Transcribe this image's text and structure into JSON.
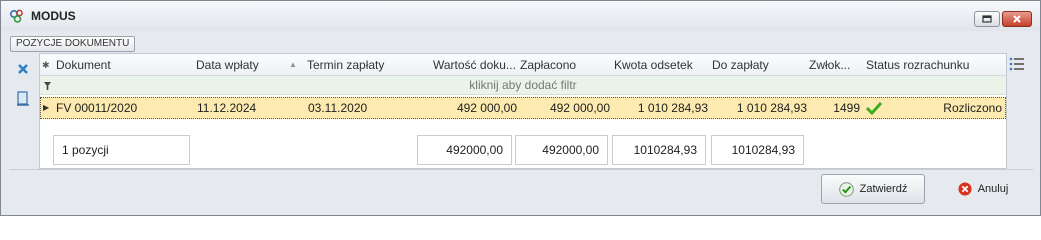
{
  "window": {
    "title": "MODUS",
    "icon": "modus-logo-icon"
  },
  "group": {
    "label": "POZYCJE DOKUMENTU"
  },
  "grid": {
    "columns": [
      "Dokument",
      "Data wpłaty",
      "Termin zapłaty",
      "Wartość doku...",
      "Zapłacono",
      "Kwota odsetek",
      "Do zapłaty",
      "Zwłok...",
      "Status rozrachunku"
    ],
    "filter_placeholder": "kliknij aby dodać filtr",
    "rows": [
      {
        "dokument": "FV 00011/2020",
        "data_wplaty": "11.12.2024",
        "termin": "03.11.2020",
        "wartosc": "492 000,00",
        "zaplacono": "492 000,00",
        "odsetki": "1 010 284,93",
        "do_zaplaty": "1 010 284,93",
        "zwloka": "1499",
        "status": "Rozliczono"
      }
    ],
    "summary": {
      "count": "1 pozycji",
      "wartosc": "492000,00",
      "zaplacono": "492000,00",
      "odsetki": "1010284,93",
      "do_zaplaty": "1010284,93"
    }
  },
  "buttons": {
    "ok": "Zatwierdź",
    "cancel": "Anuluj"
  },
  "colors": {
    "selected_row": "#fdeab0",
    "filter_row": "#eaf3e8",
    "check": "#3cae1e",
    "cancel_icon": "#d8321e"
  }
}
